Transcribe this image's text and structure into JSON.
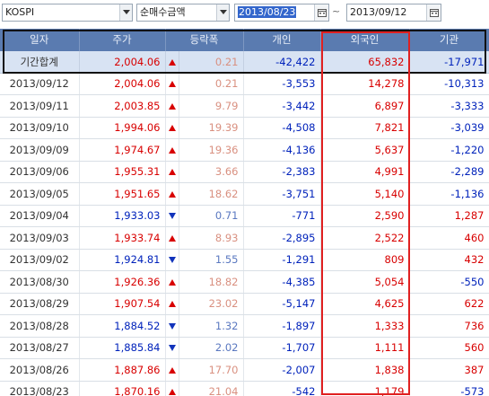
{
  "toolbar": {
    "market_select": "KOSPI",
    "type_select": "순매수금액",
    "start_date": "2013/08/23",
    "separator": "~",
    "end_date": "2013/09/12"
  },
  "table": {
    "headers": [
      "일자",
      "주가",
      "등락폭",
      "개인",
      "외국인",
      "기관"
    ],
    "summary": {
      "date": "기간합계",
      "price": "2,004.06",
      "dir": "up",
      "change": "0.21",
      "individual": "-42,422",
      "foreign": "65,832",
      "institution": "-17,971"
    },
    "rows": [
      {
        "date": "2013/09/12",
        "price": "2,004.06",
        "dir": "up",
        "change": "0.21",
        "individual": "-3,553",
        "foreign": "14,278",
        "institution": "-10,313"
      },
      {
        "date": "2013/09/11",
        "price": "2,003.85",
        "dir": "up",
        "change": "9.79",
        "individual": "-3,442",
        "foreign": "6,897",
        "institution": "-3,333"
      },
      {
        "date": "2013/09/10",
        "price": "1,994.06",
        "dir": "up",
        "change": "19.39",
        "individual": "-4,508",
        "foreign": "7,821",
        "institution": "-3,039"
      },
      {
        "date": "2013/09/09",
        "price": "1,974.67",
        "dir": "up",
        "change": "19.36",
        "individual": "-4,136",
        "foreign": "5,637",
        "institution": "-1,220"
      },
      {
        "date": "2013/09/06",
        "price": "1,955.31",
        "dir": "up",
        "change": "3.66",
        "individual": "-2,383",
        "foreign": "4,991",
        "institution": "-2,289"
      },
      {
        "date": "2013/09/05",
        "price": "1,951.65",
        "dir": "up",
        "change": "18.62",
        "individual": "-3,751",
        "foreign": "5,140",
        "institution": "-1,136"
      },
      {
        "date": "2013/09/04",
        "price": "1,933.03",
        "dir": "down",
        "change": "0.71",
        "individual": "-771",
        "foreign": "2,590",
        "institution": "1,287"
      },
      {
        "date": "2013/09/03",
        "price": "1,933.74",
        "dir": "up",
        "change": "8.93",
        "individual": "-2,895",
        "foreign": "2,522",
        "institution": "460"
      },
      {
        "date": "2013/09/02",
        "price": "1,924.81",
        "dir": "down",
        "change": "1.55",
        "individual": "-1,291",
        "foreign": "809",
        "institution": "432"
      },
      {
        "date": "2013/08/30",
        "price": "1,926.36",
        "dir": "up",
        "change": "18.82",
        "individual": "-4,385",
        "foreign": "5,054",
        "institution": "-550"
      },
      {
        "date": "2013/08/29",
        "price": "1,907.54",
        "dir": "up",
        "change": "23.02",
        "individual": "-5,147",
        "foreign": "4,625",
        "institution": "622"
      },
      {
        "date": "2013/08/28",
        "price": "1,884.52",
        "dir": "down",
        "change": "1.32",
        "individual": "-1,897",
        "foreign": "1,333",
        "institution": "736"
      },
      {
        "date": "2013/08/27",
        "price": "1,885.84",
        "dir": "down",
        "change": "2.02",
        "individual": "-1,707",
        "foreign": "1,111",
        "institution": "560"
      },
      {
        "date": "2013/08/26",
        "price": "1,887.86",
        "dir": "up",
        "change": "17.70",
        "individual": "-2,007",
        "foreign": "1,838",
        "institution": "387"
      },
      {
        "date": "2013/08/23",
        "price": "1,870.16",
        "dir": "up",
        "change": "21.04",
        "individual": "-542",
        "foreign": "1,179",
        "institution": "-573"
      }
    ]
  },
  "colors": {
    "up": "#d80000",
    "down": "#0022bb",
    "header_bg": "#5a7bb0",
    "summary_bg": "#d8e3f3",
    "highlight_red": "#e02020",
    "highlight_black": "#111111"
  }
}
